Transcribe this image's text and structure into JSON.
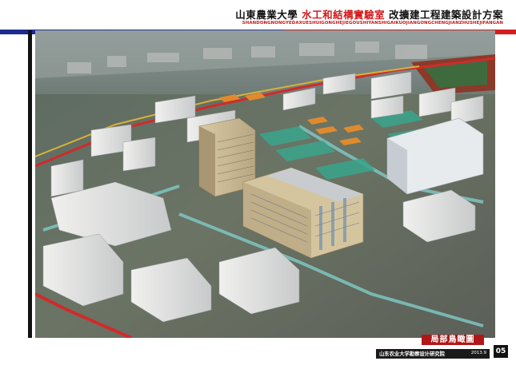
{
  "header": {
    "university": "山東農業大學",
    "lab_name": "水工和結構實驗室",
    "project": "改擴建工程建築設計方案",
    "pinyin": "SHANDONGNONGYEDAXUESHUIGONGHEJIEGOUSHIYANSHIGAIKUOJIANGONGCHENGJIANZHUSHEJIFANGAN"
  },
  "render": {
    "description_icon": "aerial-3d-rendering"
  },
  "footer": {
    "view_label": "局部鳥瞰圖",
    "institute": "山东农业大学勘察设计研究院",
    "date": "2013.9",
    "page_number": "05"
  },
  "colors": {
    "title_red": "#d21a1a",
    "rule_blue": "#1b2b8f",
    "rule_red": "#c21a1a",
    "label_red": "#b01818"
  }
}
